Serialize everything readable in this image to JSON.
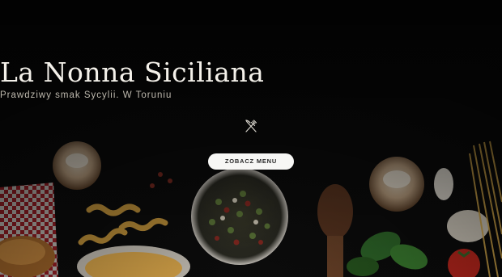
{
  "hero": {
    "title": "La Nonna Siciliana",
    "tagline": "Prawdziwy smak Sycylii. W Toruniu",
    "cta_label": "ZOBACZ MENU",
    "decor_icon": "fork-knife-icon",
    "background": "dark food photo: mushrooms, pasta, peppercorns, basil, tomato",
    "colors": {
      "title": "#f4f1ea",
      "tagline": "#bdb8ad",
      "button_bg": "#f7f7f5",
      "button_text": "#2a2a2a"
    }
  }
}
